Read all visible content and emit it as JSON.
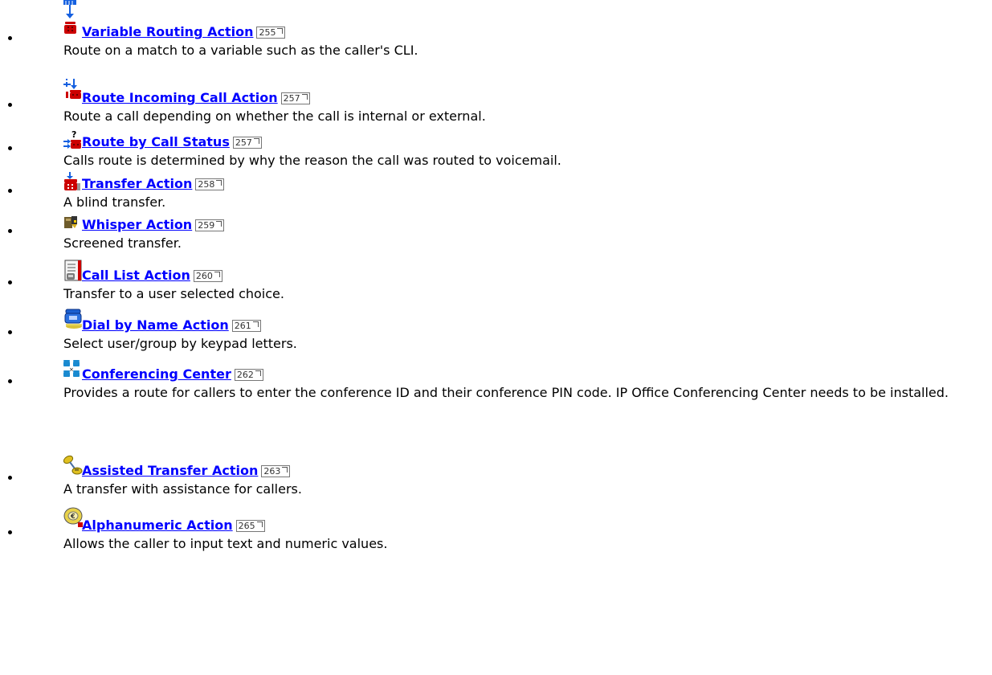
{
  "items": [
    {
      "title": "Variable Routing Action",
      "page": "255",
      "desc": "Route on a match to a variable such as the caller's CLI."
    },
    {
      "title": "Route Incoming Call Action",
      "page": "257",
      "desc": "Route a call depending on whether the call is internal or external."
    },
    {
      "title": "Route by Call Status",
      "page": "257",
      "desc": "Calls route is determined by why the reason the call was routed to voicemail."
    },
    {
      "title": "Transfer Action",
      "page": "258",
      "desc": "A blind transfer."
    },
    {
      "title": "Whisper Action",
      "page": "259",
      "desc": "Screened transfer."
    },
    {
      "title": "Call List Action",
      "page": "260",
      "desc": "Transfer to a user selected choice."
    },
    {
      "title": "Dial by Name Action",
      "page": "261",
      "desc": "Select user/group by keypad letters."
    },
    {
      "title": "Conferencing Center",
      "page": "262",
      "desc": "Provides a route for callers to enter the conference ID and their conference PIN code. IP Office Conferencing Center needs to be installed."
    },
    {
      "title": "Assisted Transfer Action",
      "page": "263",
      "desc": "A transfer with assistance for callers."
    },
    {
      "title": "Alphanumeric Action",
      "page": "265",
      "desc": "Allows the caller to input text and numeric values."
    }
  ],
  "colors": {
    "link": "#0000ff",
    "phone_red": "#cc0000",
    "blue_arrow": "#1560e0"
  }
}
